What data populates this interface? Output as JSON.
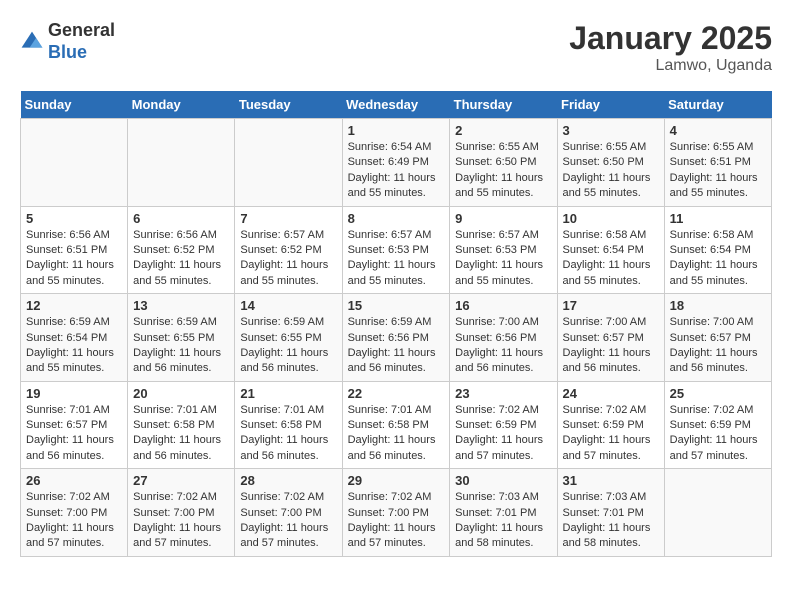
{
  "logo": {
    "general": "General",
    "blue": "Blue"
  },
  "title": "January 2025",
  "subtitle": "Lamwo, Uganda",
  "days_of_week": [
    "Sunday",
    "Monday",
    "Tuesday",
    "Wednesday",
    "Thursday",
    "Friday",
    "Saturday"
  ],
  "weeks": [
    [
      {
        "day": "",
        "sunrise": "",
        "sunset": "",
        "daylight": ""
      },
      {
        "day": "",
        "sunrise": "",
        "sunset": "",
        "daylight": ""
      },
      {
        "day": "",
        "sunrise": "",
        "sunset": "",
        "daylight": ""
      },
      {
        "day": "1",
        "sunrise": "Sunrise: 6:54 AM",
        "sunset": "Sunset: 6:49 PM",
        "daylight": "Daylight: 11 hours and 55 minutes."
      },
      {
        "day": "2",
        "sunrise": "Sunrise: 6:55 AM",
        "sunset": "Sunset: 6:50 PM",
        "daylight": "Daylight: 11 hours and 55 minutes."
      },
      {
        "day": "3",
        "sunrise": "Sunrise: 6:55 AM",
        "sunset": "Sunset: 6:50 PM",
        "daylight": "Daylight: 11 hours and 55 minutes."
      },
      {
        "day": "4",
        "sunrise": "Sunrise: 6:55 AM",
        "sunset": "Sunset: 6:51 PM",
        "daylight": "Daylight: 11 hours and 55 minutes."
      }
    ],
    [
      {
        "day": "5",
        "sunrise": "Sunrise: 6:56 AM",
        "sunset": "Sunset: 6:51 PM",
        "daylight": "Daylight: 11 hours and 55 minutes."
      },
      {
        "day": "6",
        "sunrise": "Sunrise: 6:56 AM",
        "sunset": "Sunset: 6:52 PM",
        "daylight": "Daylight: 11 hours and 55 minutes."
      },
      {
        "day": "7",
        "sunrise": "Sunrise: 6:57 AM",
        "sunset": "Sunset: 6:52 PM",
        "daylight": "Daylight: 11 hours and 55 minutes."
      },
      {
        "day": "8",
        "sunrise": "Sunrise: 6:57 AM",
        "sunset": "Sunset: 6:53 PM",
        "daylight": "Daylight: 11 hours and 55 minutes."
      },
      {
        "day": "9",
        "sunrise": "Sunrise: 6:57 AM",
        "sunset": "Sunset: 6:53 PM",
        "daylight": "Daylight: 11 hours and 55 minutes."
      },
      {
        "day": "10",
        "sunrise": "Sunrise: 6:58 AM",
        "sunset": "Sunset: 6:54 PM",
        "daylight": "Daylight: 11 hours and 55 minutes."
      },
      {
        "day": "11",
        "sunrise": "Sunrise: 6:58 AM",
        "sunset": "Sunset: 6:54 PM",
        "daylight": "Daylight: 11 hours and 55 minutes."
      }
    ],
    [
      {
        "day": "12",
        "sunrise": "Sunrise: 6:59 AM",
        "sunset": "Sunset: 6:54 PM",
        "daylight": "Daylight: 11 hours and 55 minutes."
      },
      {
        "day": "13",
        "sunrise": "Sunrise: 6:59 AM",
        "sunset": "Sunset: 6:55 PM",
        "daylight": "Daylight: 11 hours and 56 minutes."
      },
      {
        "day": "14",
        "sunrise": "Sunrise: 6:59 AM",
        "sunset": "Sunset: 6:55 PM",
        "daylight": "Daylight: 11 hours and 56 minutes."
      },
      {
        "day": "15",
        "sunrise": "Sunrise: 6:59 AM",
        "sunset": "Sunset: 6:56 PM",
        "daylight": "Daylight: 11 hours and 56 minutes."
      },
      {
        "day": "16",
        "sunrise": "Sunrise: 7:00 AM",
        "sunset": "Sunset: 6:56 PM",
        "daylight": "Daylight: 11 hours and 56 minutes."
      },
      {
        "day": "17",
        "sunrise": "Sunrise: 7:00 AM",
        "sunset": "Sunset: 6:57 PM",
        "daylight": "Daylight: 11 hours and 56 minutes."
      },
      {
        "day": "18",
        "sunrise": "Sunrise: 7:00 AM",
        "sunset": "Sunset: 6:57 PM",
        "daylight": "Daylight: 11 hours and 56 minutes."
      }
    ],
    [
      {
        "day": "19",
        "sunrise": "Sunrise: 7:01 AM",
        "sunset": "Sunset: 6:57 PM",
        "daylight": "Daylight: 11 hours and 56 minutes."
      },
      {
        "day": "20",
        "sunrise": "Sunrise: 7:01 AM",
        "sunset": "Sunset: 6:58 PM",
        "daylight": "Daylight: 11 hours and 56 minutes."
      },
      {
        "day": "21",
        "sunrise": "Sunrise: 7:01 AM",
        "sunset": "Sunset: 6:58 PM",
        "daylight": "Daylight: 11 hours and 56 minutes."
      },
      {
        "day": "22",
        "sunrise": "Sunrise: 7:01 AM",
        "sunset": "Sunset: 6:58 PM",
        "daylight": "Daylight: 11 hours and 56 minutes."
      },
      {
        "day": "23",
        "sunrise": "Sunrise: 7:02 AM",
        "sunset": "Sunset: 6:59 PM",
        "daylight": "Daylight: 11 hours and 57 minutes."
      },
      {
        "day": "24",
        "sunrise": "Sunrise: 7:02 AM",
        "sunset": "Sunset: 6:59 PM",
        "daylight": "Daylight: 11 hours and 57 minutes."
      },
      {
        "day": "25",
        "sunrise": "Sunrise: 7:02 AM",
        "sunset": "Sunset: 6:59 PM",
        "daylight": "Daylight: 11 hours and 57 minutes."
      }
    ],
    [
      {
        "day": "26",
        "sunrise": "Sunrise: 7:02 AM",
        "sunset": "Sunset: 7:00 PM",
        "daylight": "Daylight: 11 hours and 57 minutes."
      },
      {
        "day": "27",
        "sunrise": "Sunrise: 7:02 AM",
        "sunset": "Sunset: 7:00 PM",
        "daylight": "Daylight: 11 hours and 57 minutes."
      },
      {
        "day": "28",
        "sunrise": "Sunrise: 7:02 AM",
        "sunset": "Sunset: 7:00 PM",
        "daylight": "Daylight: 11 hours and 57 minutes."
      },
      {
        "day": "29",
        "sunrise": "Sunrise: 7:02 AM",
        "sunset": "Sunset: 7:00 PM",
        "daylight": "Daylight: 11 hours and 57 minutes."
      },
      {
        "day": "30",
        "sunrise": "Sunrise: 7:03 AM",
        "sunset": "Sunset: 7:01 PM",
        "daylight": "Daylight: 11 hours and 58 minutes."
      },
      {
        "day": "31",
        "sunrise": "Sunrise: 7:03 AM",
        "sunset": "Sunset: 7:01 PM",
        "daylight": "Daylight: 11 hours and 58 minutes."
      },
      {
        "day": "",
        "sunrise": "",
        "sunset": "",
        "daylight": ""
      }
    ]
  ]
}
